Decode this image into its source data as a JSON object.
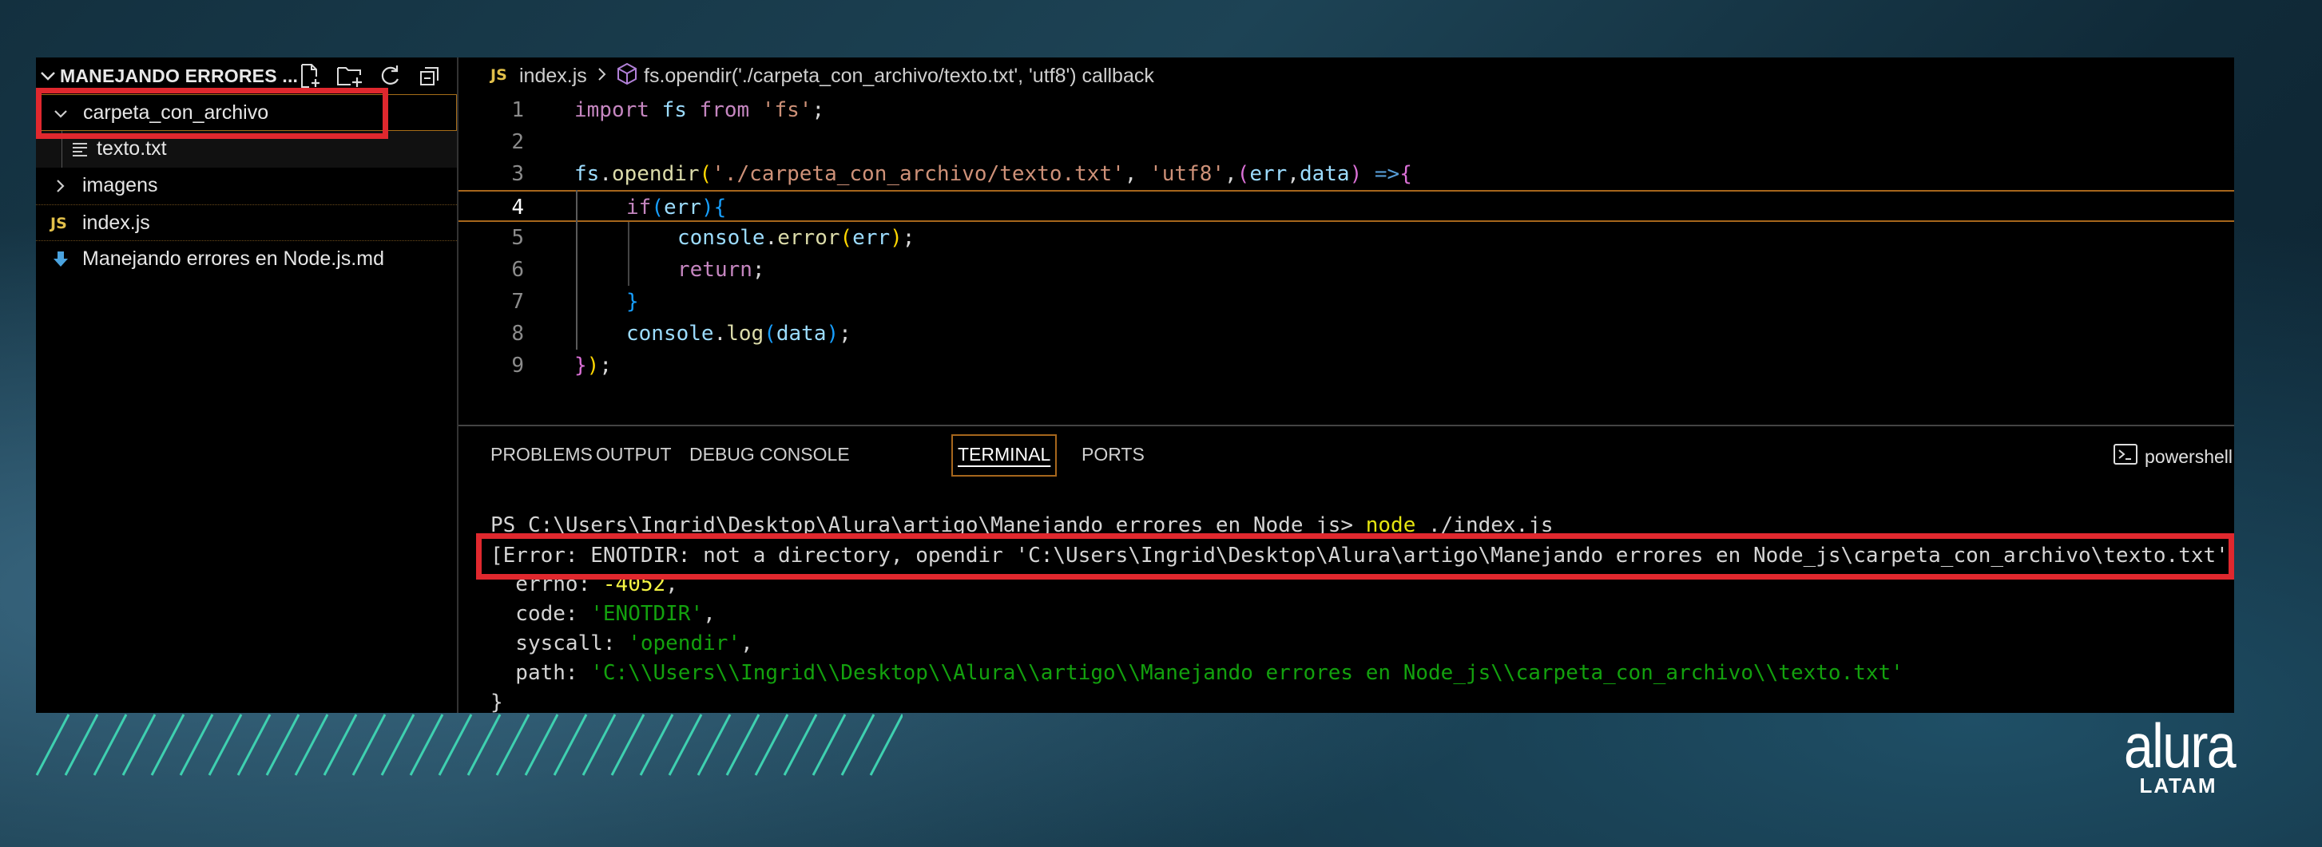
{
  "explorer": {
    "title": "MANEJANDO ERRORES ...",
    "items": [
      {
        "label": "carpeta_con_archivo",
        "type": "folder-open"
      },
      {
        "label": "texto.txt",
        "type": "file-text"
      },
      {
        "label": "imagens",
        "type": "folder-closed"
      },
      {
        "label": "index.js",
        "type": "file-js"
      },
      {
        "label": "Manejando errores en Node.js.md",
        "type": "file-markdown"
      }
    ],
    "js_badge": "JS"
  },
  "editor": {
    "breadcrumb_file": "index.js",
    "breadcrumb_symbol": "fs.opendir('./carpeta_con_archivo/texto.txt', 'utf8') callback",
    "line_numbers": [
      "1",
      "2",
      "3",
      "4",
      "5",
      "6",
      "7",
      "8",
      "9"
    ]
  },
  "panel": {
    "tabs": [
      "PROBLEMS",
      "OUTPUT",
      "DEBUG CONSOLE",
      "TERMINAL",
      "PORTS"
    ],
    "active_tab": "TERMINAL",
    "shell": "powershell",
    "terminal": {
      "prompt": "PS C:\\Users\\Ingrid\\Desktop\\Alura\\artigo\\Manejando errores en Node_js> ",
      "command": "node",
      "args": " ./index.js",
      "error_line": "[Error: ENOTDIR: not a directory, opendir 'C:\\Users\\Ingrid\\Desktop\\Alura\\artigo\\Manejando errores en Node_js\\carpeta_con_archivo\\texto.txt'] {",
      "errno_key": "  errno: ",
      "errno_val": "-4052",
      "errno_tail": ",",
      "code_key": "  code: ",
      "code_val": "'ENOTDIR'",
      "code_tail": ",",
      "syscall_key": "  syscall: ",
      "syscall_val": "'opendir'",
      "syscall_tail": ",",
      "path_key": "  path: ",
      "path_val": "'C:\\\\Users\\\\Ingrid\\\\Desktop\\\\Alura\\\\artigo\\\\Manejando errores en Node_js\\\\carpeta_con_archivo\\\\texto.txt'",
      "close": "}"
    }
  },
  "logo": {
    "word": "alura",
    "sub": "LATAM"
  },
  "colors": {
    "highlight_box": "#e0282e",
    "accent_orange": "#a6661c"
  }
}
